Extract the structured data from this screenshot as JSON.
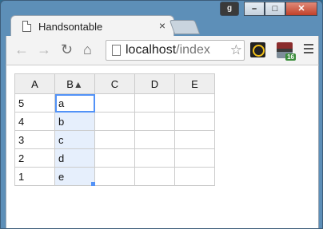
{
  "window": {
    "tab_title": "Handsontable",
    "tab_close": "×",
    "profile_label": "g",
    "minimize": "–",
    "maximize": "□",
    "close": "✕"
  },
  "toolbar": {
    "back": "←",
    "forward": "→",
    "reload": "↻",
    "home": "⌂",
    "url_host": "localhost",
    "url_path": "/index",
    "star": "☆",
    "ext_badge": "16"
  },
  "table": {
    "headers": [
      "A",
      "B",
      "C",
      "D",
      "E"
    ],
    "sort_indicator": "▲",
    "rows": [
      [
        "5",
        "a",
        "",
        "",
        ""
      ],
      [
        "4",
        "b",
        "",
        "",
        ""
      ],
      [
        "3",
        "c",
        "",
        "",
        ""
      ],
      [
        "2",
        "d",
        "",
        "",
        ""
      ],
      [
        "1",
        "e",
        "",
        "",
        ""
      ]
    ]
  }
}
